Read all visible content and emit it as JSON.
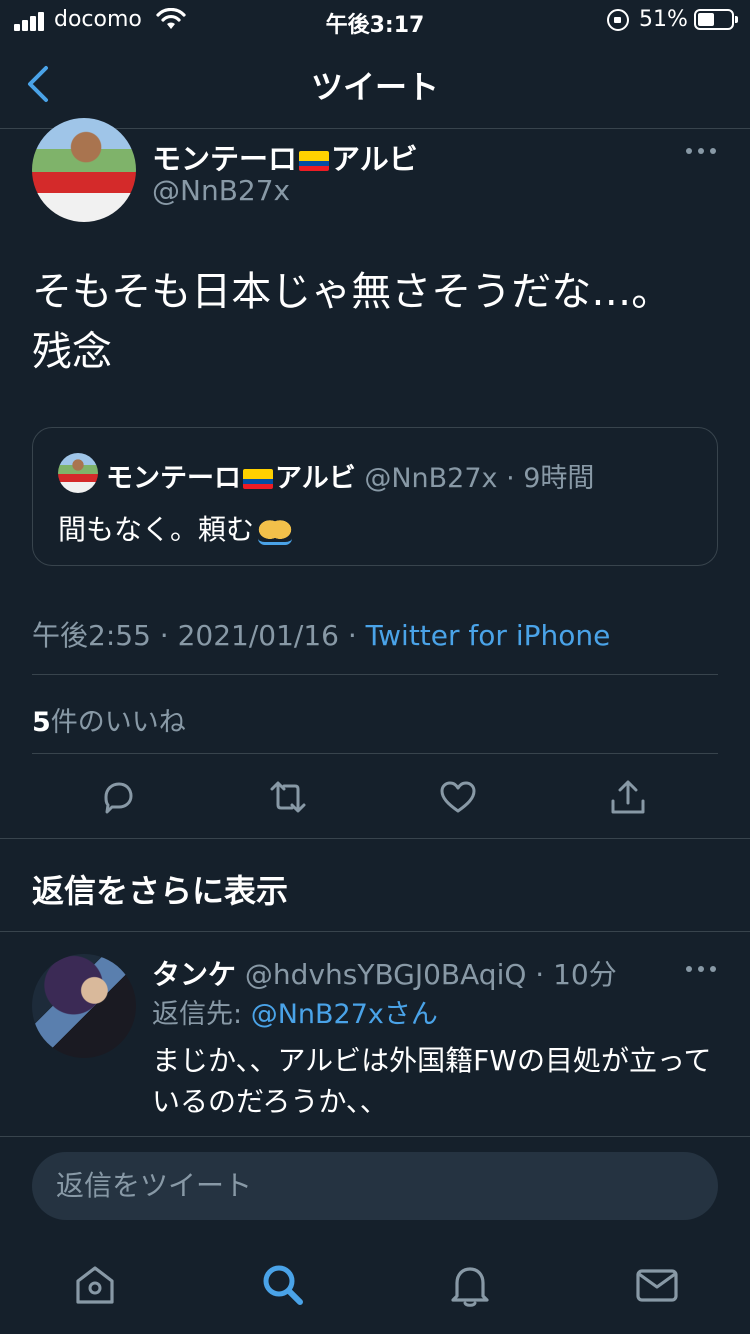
{
  "status_bar": {
    "carrier": "docomo",
    "time": "午後3:17",
    "battery": "51%",
    "battery_level": 0.51
  },
  "nav": {
    "back_icon": "chevron-left-icon",
    "title": "ツイート"
  },
  "tweet": {
    "author_name_part1": "モンテーロ",
    "author_name_part2": "アルビ",
    "flag_icon": "ecuador-flag-icon",
    "author_handle": "@NnB27x",
    "text_line1": "そもそも日本じゃ無さそうだな…。",
    "text_line2": "残念",
    "timestamp": "午後2:55 · 2021/01/16 · ",
    "source": "Twitter for iPhone",
    "likes_count": "5",
    "likes_label": "件のいいね"
  },
  "quoted_tweet": {
    "author_name_part1": "モンテーロ",
    "author_name_part2": "アルビ",
    "meta": "@NnB27x · 9時間",
    "text": "間もなく。頼む",
    "emoji": "folded-hands-emoji"
  },
  "actions": [
    "reply-icon",
    "retweet-icon",
    "like-icon",
    "share-icon"
  ],
  "more_replies": {
    "title": "返信をさらに表示"
  },
  "reply": {
    "author_name": "タンケ",
    "meta": "@hdvhsYBGJ0BAqiQ · 10分",
    "reply_to_label": "返信先: ",
    "reply_to_handle": "@NnB27xさん",
    "text": "まじか、、アルビは外国籍FWの目処が立っているのだろうか、、"
  },
  "compose": {
    "placeholder": "返信をツイート"
  },
  "tab_bar": [
    "home-icon",
    "search-icon",
    "notifications-icon",
    "messages-icon"
  ],
  "colors": {
    "background": "#15202b",
    "accent": "#4aa3e8",
    "secondary_text": "#8899a6",
    "divider": "#38444d"
  }
}
